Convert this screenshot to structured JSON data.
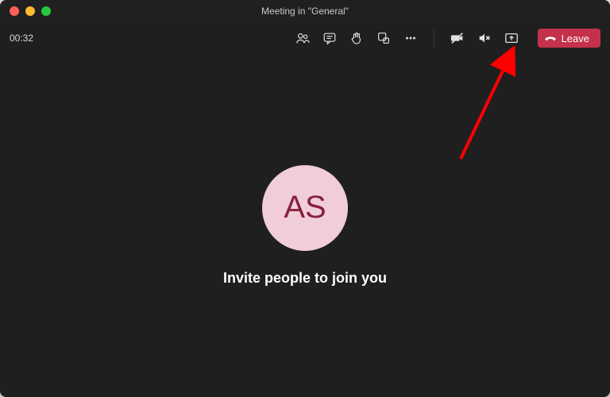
{
  "titlebar": {
    "title": "Meeting in \"General\""
  },
  "toolbar": {
    "timer": "00:32",
    "icons": {
      "people": "people-icon",
      "chat": "chat-icon",
      "raise_hand": "raise-hand-icon",
      "rooms": "breakout-rooms-icon",
      "more": "more-icon",
      "camera_off": "camera-off-icon",
      "audio_off": "audio-off-icon",
      "share": "share-screen-icon"
    },
    "leave_label": "Leave"
  },
  "main": {
    "avatar_initials": "AS",
    "invite_text": "Invite people to join you"
  },
  "colors": {
    "bg": "#1f1f1f",
    "leave": "#c4314b",
    "avatar_bg": "#f1cdd8",
    "avatar_fg": "#862040",
    "arrow": "#ff0000"
  },
  "annotation": {
    "arrow_target": "share-screen-icon"
  }
}
